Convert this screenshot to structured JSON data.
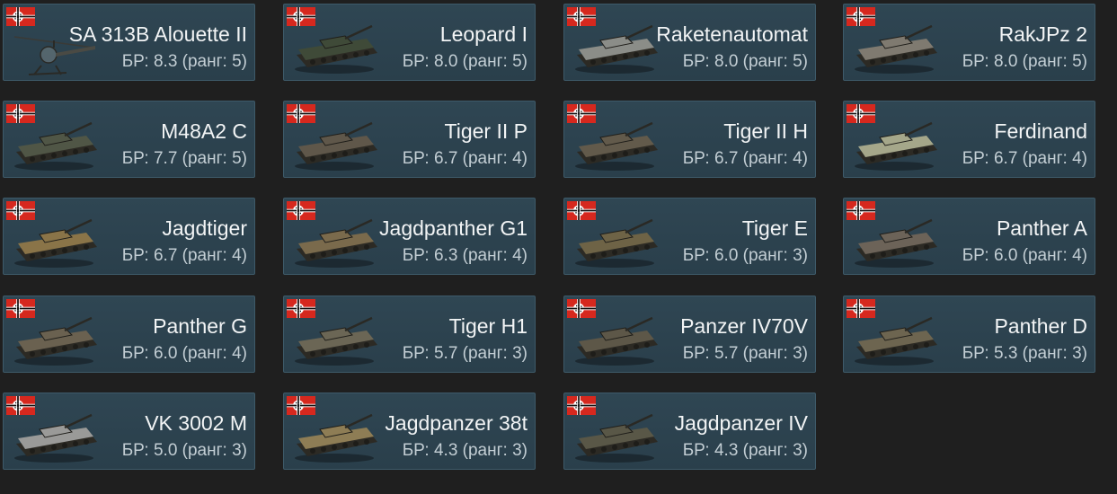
{
  "nation_flag_icon": "german-ww2-flag-icon",
  "vehicles": [
    {
      "name": "SA 313B Alouette II",
      "br": "БР: 8.3 (ранг: 5)",
      "kind": "helicopter",
      "camo": "#4a4a44"
    },
    {
      "name": "Leopard I",
      "br": "БР: 8.0 (ранг: 5)",
      "kind": "tank",
      "camo": "#3f4a38"
    },
    {
      "name": "Raketenautomat",
      "br": "БР: 8.0 (ранг: 5)",
      "kind": "tank",
      "camo": "#8b8d88"
    },
    {
      "name": "RakJPz 2",
      "br": "БР: 8.0 (ранг: 5)",
      "kind": "tank",
      "camo": "#7f7a70"
    },
    {
      "name": "M48A2 C",
      "br": "БР: 7.7 (ранг: 5)",
      "kind": "tank",
      "camo": "#505646"
    },
    {
      "name": "Tiger II P",
      "br": "БР: 6.7 (ранг: 4)",
      "kind": "tank",
      "camo": "#5f574a"
    },
    {
      "name": "Tiger II H",
      "br": "БР: 6.7 (ранг: 4)",
      "kind": "tank",
      "camo": "#625a4b"
    },
    {
      "name": "Ferdinand",
      "br": "БР: 6.7 (ранг: 4)",
      "kind": "tank",
      "camo": "#a5a78a"
    },
    {
      "name": "Jagdtiger",
      "br": "БР: 6.7 (ранг: 4)",
      "kind": "tank",
      "camo": "#8a7448"
    },
    {
      "name": "Jagdpanther G1",
      "br": "БР: 6.3 (ранг: 4)",
      "kind": "tank",
      "camo": "#7a6a4c"
    },
    {
      "name": "Tiger E",
      "br": "БР: 6.0 (ранг: 3)",
      "kind": "tank",
      "camo": "#6e6346"
    },
    {
      "name": "Panther A",
      "br": "БР: 6.0 (ранг: 4)",
      "kind": "tank",
      "camo": "#6c6358"
    },
    {
      "name": "Panther G",
      "br": "БР: 6.0 (ранг: 4)",
      "kind": "tank",
      "camo": "#6a6150"
    },
    {
      "name": "Tiger H1",
      "br": "БР: 5.7 (ранг: 3)",
      "kind": "tank",
      "camo": "#6b6655"
    },
    {
      "name": "Panzer IV70V",
      "br": "БР: 5.7 (ранг: 3)",
      "kind": "tank",
      "camo": "#5d5748"
    },
    {
      "name": "Panther D",
      "br": "БР: 5.3 (ранг: 3)",
      "kind": "tank",
      "camo": "#6d6550"
    },
    {
      "name": "VK 3002 M",
      "br": "БР: 5.0 (ранг: 3)",
      "kind": "tank",
      "camo": "#9a9a98"
    },
    {
      "name": "Jagdpanzer 38t",
      "br": "БР: 4.3 (ранг: 3)",
      "kind": "tank",
      "camo": "#8e7d55"
    },
    {
      "name": "Jagdpanzer IV",
      "br": "БР: 4.3 (ранг: 3)",
      "kind": "tank",
      "camo": "#595747"
    }
  ]
}
